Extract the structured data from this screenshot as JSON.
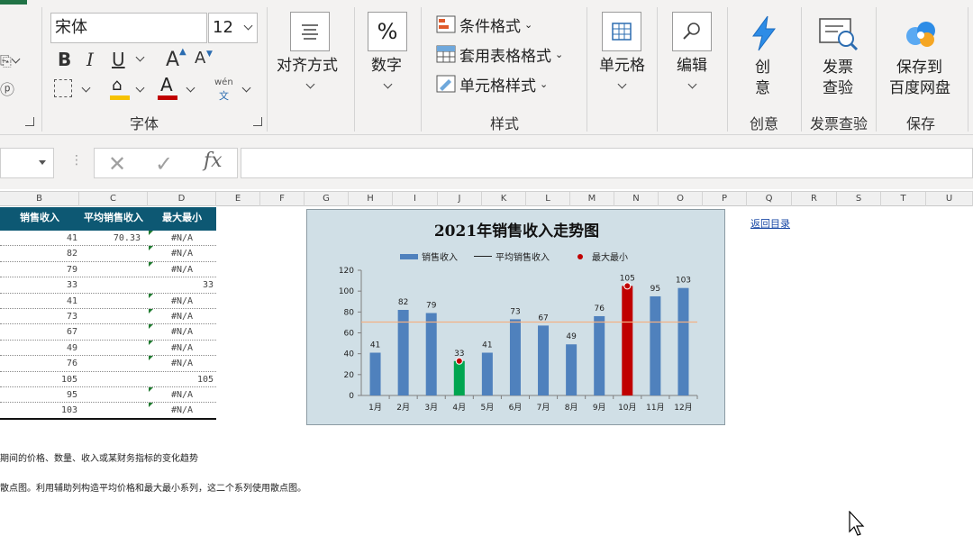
{
  "ribbon": {
    "font_name": "宋体",
    "font_size": "12",
    "bold": "B",
    "italic": "I",
    "underline": "U",
    "grow_font": "A",
    "shrink_font": "A",
    "phonetic_top": "wén",
    "phonetic_bottom": "文",
    "font_group_label": "字体",
    "align_label": "对齐方式",
    "number_label": "数字",
    "number_icon": "%",
    "conditional_format": "条件格式",
    "table_format": "套用表格格式",
    "cell_style": "单元格样式",
    "styles_group_label": "样式",
    "cells_label": "单元格",
    "edit_label": "编辑",
    "creative_label_1": "创",
    "creative_label_2": "意",
    "creative_group_label": "创意",
    "invoice_label_1": "发票",
    "invoice_label_2": "查验",
    "invoice_group_label": "发票查验",
    "save_label_1": "保存到",
    "save_label_2": "百度网盘",
    "save_group_label": "保存",
    "fill_color": "#f6c200",
    "font_color": "#c00000",
    "accent": "#217346"
  },
  "formula_bar": {
    "cancel": "✕",
    "enter": "✓",
    "fx": "fx",
    "value": ""
  },
  "columns": [
    "B",
    "C",
    "D",
    "E",
    "F",
    "G",
    "H",
    "I",
    "J",
    "K",
    "L",
    "M",
    "N",
    "O",
    "P",
    "Q",
    "R",
    "S",
    "T",
    "U"
  ],
  "table": {
    "headers": [
      "销售收入",
      "平均销售收入",
      "最大最小"
    ],
    "rows": [
      {
        "b": "41",
        "c": "70.33",
        "d": "#N/A"
      },
      {
        "b": "82",
        "c": "",
        "d": "#N/A"
      },
      {
        "b": "79",
        "c": "",
        "d": "#N/A"
      },
      {
        "b": "33",
        "c": "",
        "d": "33"
      },
      {
        "b": "41",
        "c": "",
        "d": "#N/A"
      },
      {
        "b": "73",
        "c": "",
        "d": "#N/A"
      },
      {
        "b": "67",
        "c": "",
        "d": "#N/A"
      },
      {
        "b": "49",
        "c": "",
        "d": "#N/A"
      },
      {
        "b": "76",
        "c": "",
        "d": "#N/A"
      },
      {
        "b": "105",
        "c": "",
        "d": "105"
      },
      {
        "b": "95",
        "c": "",
        "d": "#N/A"
      },
      {
        "b": "103",
        "c": "",
        "d": "#N/A"
      }
    ]
  },
  "notes": [
    "期间的价格、数量、收入或某财务指标的变化趋势",
    "散点图。利用辅助列构造平均价格和最大最小系列，这二个系列使用散点图。"
  ],
  "link_text": "返回目录",
  "chart_data": {
    "type": "bar",
    "title": "2021年销售收入走势图",
    "categories": [
      "1月",
      "2月",
      "3月",
      "4月",
      "5月",
      "6月",
      "7月",
      "8月",
      "9月",
      "10月",
      "11月",
      "12月"
    ],
    "series": [
      {
        "name": "销售收入",
        "values": [
          41,
          82,
          79,
          33,
          41,
          73,
          67,
          49,
          76,
          105,
          95,
          103
        ],
        "color": "#4f81bd"
      },
      {
        "name": "平均销售收入",
        "values": [
          70.33,
          70.33,
          70.33,
          70.33,
          70.33,
          70.33,
          70.33,
          70.33,
          70.33,
          70.33,
          70.33,
          70.33
        ],
        "color": "#f4b183"
      },
      {
        "name": "最大最小",
        "values": [
          null,
          null,
          null,
          33,
          null,
          null,
          null,
          null,
          null,
          105,
          null,
          null
        ],
        "color": "#c00000"
      }
    ],
    "highlight_colors": {
      "min": "#00a550",
      "max": "#c00000"
    },
    "ylim": [
      0,
      120
    ],
    "yticks": [
      0,
      20,
      40,
      60,
      80,
      100,
      120
    ],
    "legend": "top",
    "grid": false
  }
}
